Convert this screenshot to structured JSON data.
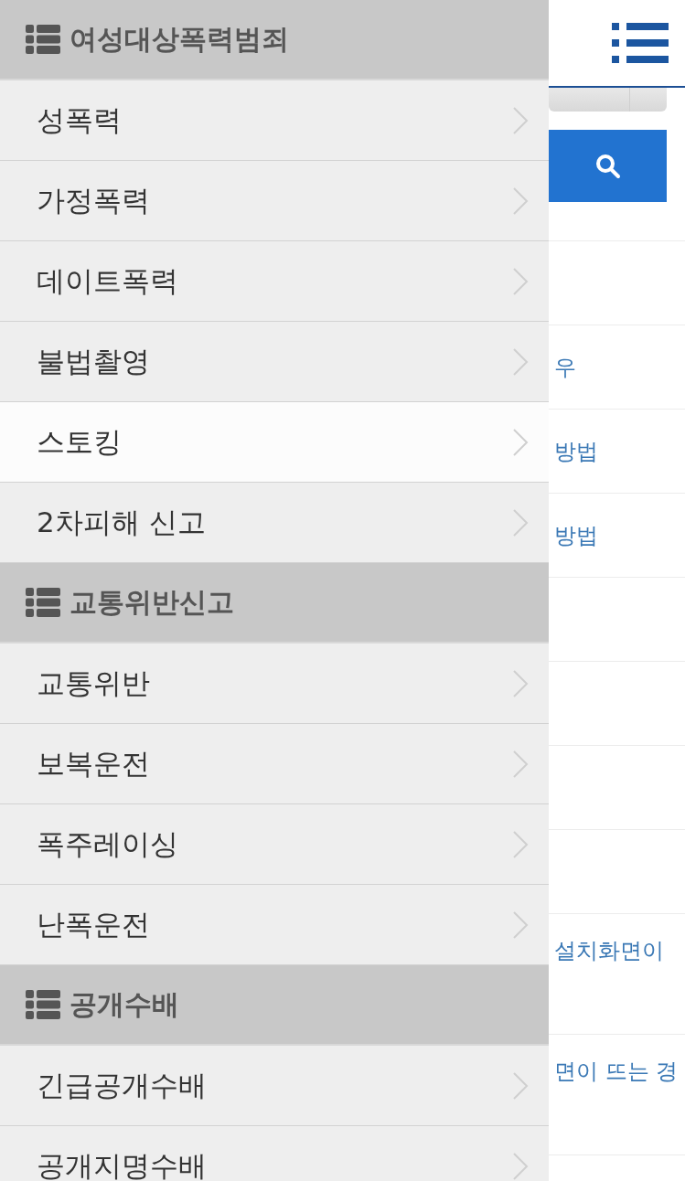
{
  "page": {
    "rows": [
      {
        "kind": "blank"
      },
      {
        "kind": "link",
        "text": "우"
      },
      {
        "kind": "link",
        "text": "방법"
      },
      {
        "kind": "link",
        "text": "방법"
      },
      {
        "kind": "blank"
      },
      {
        "kind": "blank"
      },
      {
        "kind": "blank"
      },
      {
        "kind": "blank"
      },
      {
        "kind": "tall-link",
        "text": "설치화면이"
      },
      {
        "kind": "tall-link",
        "text": "면이 뜨는 경"
      },
      {
        "kind": "blank"
      }
    ]
  },
  "drawer": {
    "sections": [
      {
        "title": "여성대상폭력범죄",
        "items": [
          {
            "label": "성폭력",
            "selected": false
          },
          {
            "label": "가정폭력",
            "selected": false
          },
          {
            "label": "데이트폭력",
            "selected": false
          },
          {
            "label": "불법촬영",
            "selected": false
          },
          {
            "label": "스토킹",
            "selected": true
          },
          {
            "label": "2차피해 신고",
            "selected": false
          }
        ]
      },
      {
        "title": "교통위반신고",
        "items": [
          {
            "label": "교통위반",
            "selected": false
          },
          {
            "label": "보복운전",
            "selected": false
          },
          {
            "label": "폭주레이싱",
            "selected": false
          },
          {
            "label": "난폭운전",
            "selected": false
          }
        ]
      },
      {
        "title": "공개수배",
        "items": [
          {
            "label": "긴급공개수배",
            "selected": false
          },
          {
            "label": "공개지명수배",
            "selected": false
          }
        ]
      }
    ]
  }
}
